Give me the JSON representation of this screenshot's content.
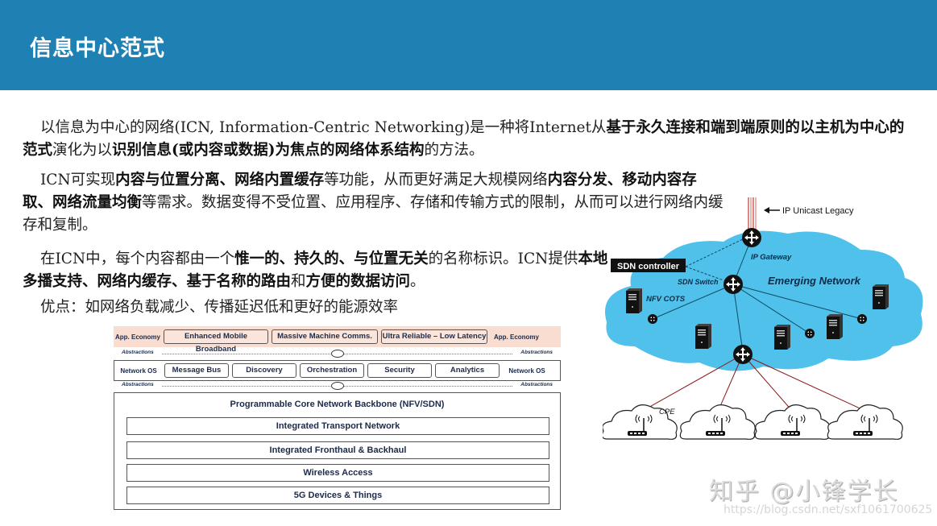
{
  "header": {
    "title": "信息中心范式",
    "bg_color": "#1f80b4"
  },
  "paragraphs": {
    "p1": [
      {
        "t": "以信息为中心的网络(ICN, Information-Centric Networking)是一种将Internet从",
        "b": false
      },
      {
        "t": "基于永久连接和端到端原则的以主机为中心的范式",
        "b": true
      },
      {
        "t": "演化为以",
        "b": false
      },
      {
        "t": "识别信息(或内容或数据)为焦点的网络体系结构",
        "b": true
      },
      {
        "t": "的方法。",
        "b": false
      }
    ],
    "p2": [
      {
        "t": "ICN可实现",
        "b": false
      },
      {
        "t": "内容与位置分离、网络内置缓存",
        "b": true
      },
      {
        "t": "等功能，从而更好满足大规模网络",
        "b": false
      },
      {
        "t": "内容分发、移动内容存取、网络流量均衡",
        "b": true
      },
      {
        "t": "等需求。数据变得不受位置、应用程序、存储和传输方式的限制，从而可以进行网络内缓存和复制。",
        "b": false
      }
    ],
    "p3": [
      {
        "t": "在ICN中，每个内容都由一个",
        "b": false
      },
      {
        "t": "惟一的、持久的、与位置无关",
        "b": true
      },
      {
        "t": "的名称标识。ICN提供",
        "b": false
      },
      {
        "t": "本地多播支持、网络内缓存、基于名称的路由",
        "b": true
      },
      {
        "t": "和",
        "b": false
      },
      {
        "t": "方便的数据访问",
        "b": true
      },
      {
        "t": "。",
        "b": false
      }
    ],
    "p4": [
      {
        "t": "优点：如网络负载减少、传播延迟低和更好的能源效率",
        "b": false
      }
    ]
  },
  "stack": {
    "econ_side": "App. Economy",
    "econ_items": [
      "Enhanced Mobile Broadband",
      "Massive Machine Comms.",
      "Ultra Reliable – Low Latency"
    ],
    "abstractions": "Abstractions",
    "os_side": "Network OS",
    "os_items": [
      "Message Bus",
      "Discovery",
      "Orchestration",
      "Security",
      "Analytics"
    ],
    "core_title": "Programmable Core Network Backbone (NFV/SDN)",
    "layers": [
      "Integrated Transport Network",
      "Integrated Fronthaul & Backhaul",
      "Wireless Access",
      "5G Devices & Things"
    ]
  },
  "network": {
    "legacy_label": "IP Unicast Legacy",
    "gateway_label": "IP Gateway",
    "controller_label": "SDN controller",
    "switch_label": "SDN Switch",
    "cloud_label": "Emerging Network",
    "nfv_label": "NFV COTS",
    "cpe_label": "CPE",
    "cloud_color": "#4fc1ea"
  },
  "watermark": {
    "main": "知乎 @小锋学长",
    "url": "https://blog.csdn.net/sxf1061700625"
  }
}
